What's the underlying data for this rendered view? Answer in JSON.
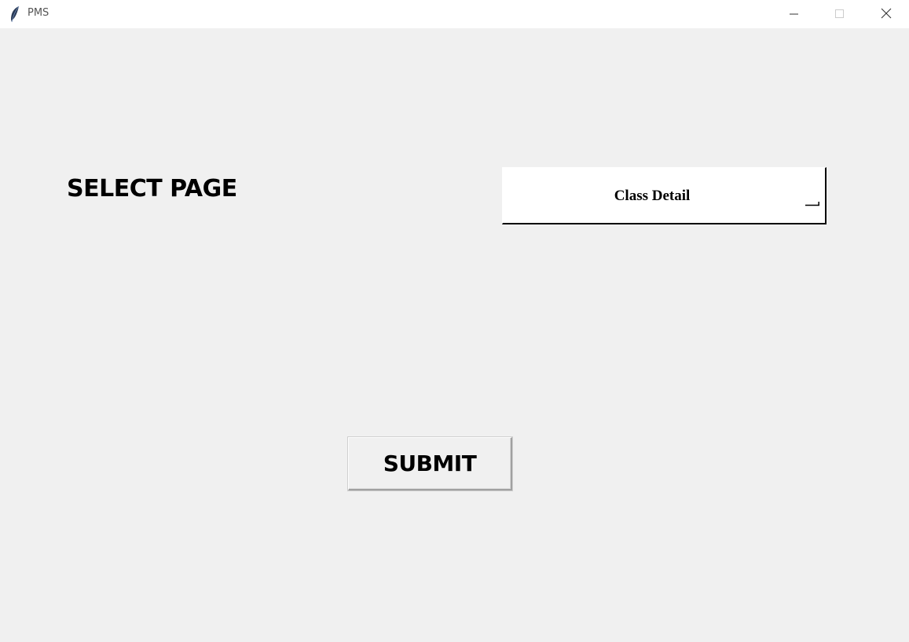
{
  "window": {
    "title": "PMS",
    "icon": "feather-icon",
    "controls": [
      "minimize-icon",
      "maximize-icon",
      "close-icon"
    ]
  },
  "form": {
    "select_label": "SELECT PAGE",
    "dropdown": {
      "selected": "Class Detail",
      "indicator_icon": "option-menu-indicator-icon"
    },
    "submit_label": "SUBMIT"
  },
  "colors": {
    "background": "#f0f0f0",
    "titlebar": "#ffffff",
    "text": "#000000"
  }
}
